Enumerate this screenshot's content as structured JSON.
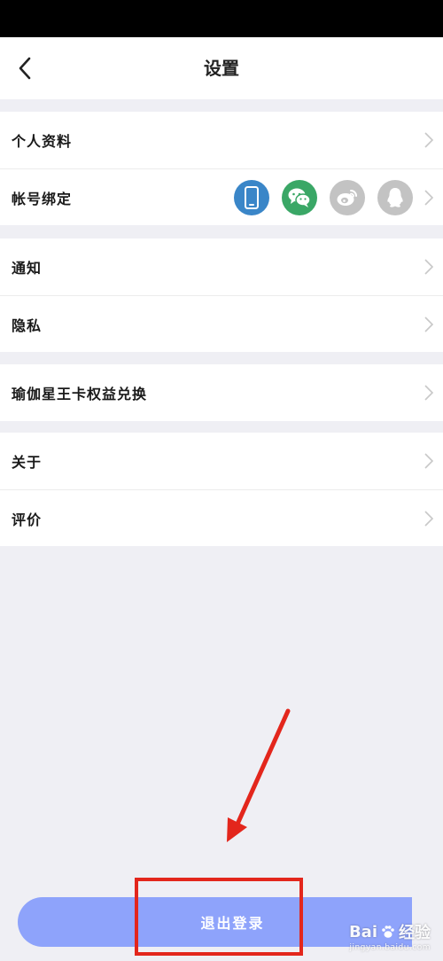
{
  "nav": {
    "title": "设置"
  },
  "groups": [
    {
      "items": [
        {
          "label": "个人资料"
        },
        {
          "label": "帐号绑定"
        }
      ]
    },
    {
      "items": [
        {
          "label": "通知"
        },
        {
          "label": "隐私"
        }
      ]
    },
    {
      "items": [
        {
          "label": "瑜伽星王卡权益兑换"
        }
      ]
    },
    {
      "items": [
        {
          "label": "关于"
        },
        {
          "label": "评价"
        }
      ]
    }
  ],
  "account_binding": {
    "icons": [
      {
        "name": "phone-icon",
        "color": "#3a86c8",
        "bound": true
      },
      {
        "name": "wechat-icon",
        "color": "#3aa766",
        "bound": true
      },
      {
        "name": "weibo-icon",
        "color": "#c3c3c3",
        "bound": false
      },
      {
        "name": "qq-icon",
        "color": "#c3c3c3",
        "bound": false
      }
    ]
  },
  "logout": {
    "label": "退出登录"
  },
  "watermark": {
    "brand_latin": "Bai",
    "brand_cn": "经验",
    "sub": "jingyan.baidu.com"
  },
  "colors": {
    "accent": "#8ea3fb",
    "annotation": "#e3261c",
    "background": "#efeff4"
  }
}
